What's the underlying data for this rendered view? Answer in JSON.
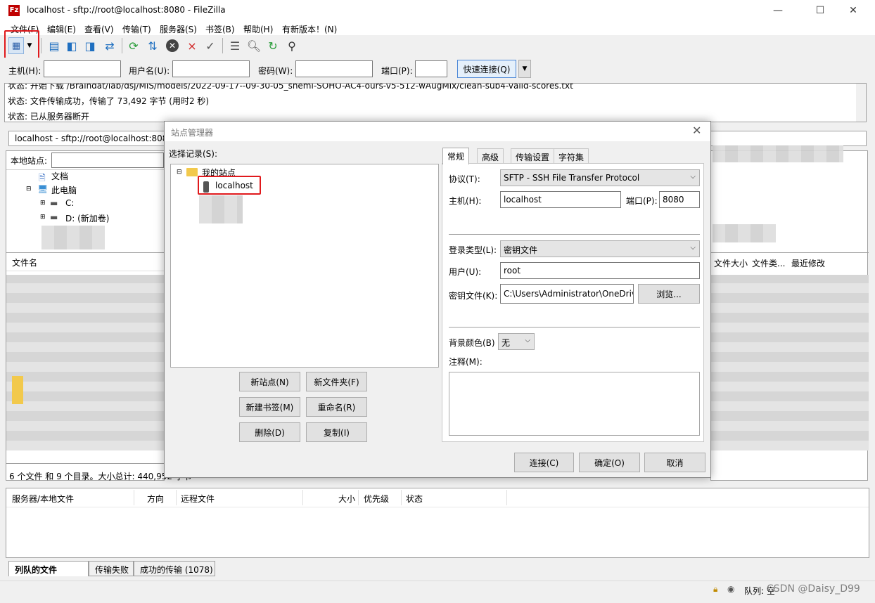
{
  "window": {
    "title": "localhost - sftp://root@localhost:8080 - FileZilla",
    "minimize": "—",
    "maximize": "☐",
    "close": "✕"
  },
  "menu": [
    "文件(F)",
    "编辑(E)",
    "查看(V)",
    "传输(T)",
    "服务器(S)",
    "书签(B)",
    "帮助(H)",
    "有新版本！(N)"
  ],
  "quickconnect": {
    "host_label": "主机(H):",
    "user_label": "用户名(U):",
    "pass_label": "密码(W):",
    "port_label": "端口(P):",
    "button": "快速连接(Q)"
  },
  "log": {
    "lines": [
      "状态:    开始下载 /Braindat/lab/dsj/MIS/models/2022-09-17--09-30-05_shemi-SOHO-AC4-ours-v5-512-wAugMix/clean-sub4-valid-scores.txt",
      "状态:    文件传输成功，传输了 73,492 字节 (用时2 秒)",
      "状态:    已从服务器断开"
    ]
  },
  "session_tab": "localhost - sftp://root@localhost:8080",
  "local": {
    "site_label": "本地站点:",
    "tree": [
      "文档",
      "此电脑",
      "C:",
      "D: (新加卷)"
    ],
    "col_filename": "文件名",
    "summary": "6 个文件 和 9 个目录。大小总计: 440,952 字节"
  },
  "remote": {
    "col_size": "文件大小",
    "col_type": "文件类...",
    "col_modified": "最近修改"
  },
  "queue": {
    "headers": [
      "服务器/本地文件",
      "方向",
      "远程文件",
      "大小",
      "优先级",
      "状态"
    ],
    "tabs": [
      "列队的文件",
      "传输失败",
      "成功的传输 (1078)"
    ]
  },
  "statusbar": {
    "queue_text": "队列: 空",
    "watermark": "CSDN @Daisy_D99"
  },
  "dialog": {
    "title": "站点管理器",
    "select_label": "选择记录(S):",
    "tree_root": "我的站点",
    "tree_site": "localhost",
    "buttons": {
      "new_site": "新站点(N)",
      "new_folder": "新文件夹(F)",
      "new_bookmark": "新建书签(M)",
      "rename": "重命名(R)",
      "delete": "删除(D)",
      "copy": "复制(I)",
      "connect": "连接(C)",
      "ok": "确定(O)",
      "cancel": "取消"
    },
    "tabs": [
      "常规",
      "高级",
      "传输设置",
      "字符集"
    ],
    "general": {
      "protocol_label": "协议(T):",
      "protocol_value": "SFTP - SSH File Transfer Protocol",
      "host_label": "主机(H):",
      "host_value": "localhost",
      "port_label": "端口(P):",
      "port_value": "8080",
      "logon_label": "登录类型(L):",
      "logon_value": "密钥文件",
      "user_label": "用户(U):",
      "user_value": "root",
      "keyfile_label": "密钥文件(K):",
      "keyfile_value": "C:\\Users\\Administrator\\OneDrive",
      "browse": "浏览...",
      "bgcolor_label": "背景颜色(B)",
      "bgcolor_value": "无",
      "comments_label": "注释(M):"
    }
  },
  "colors": {
    "highlight_red": "#e0191c",
    "folder_yellow": "#f2c94c"
  }
}
